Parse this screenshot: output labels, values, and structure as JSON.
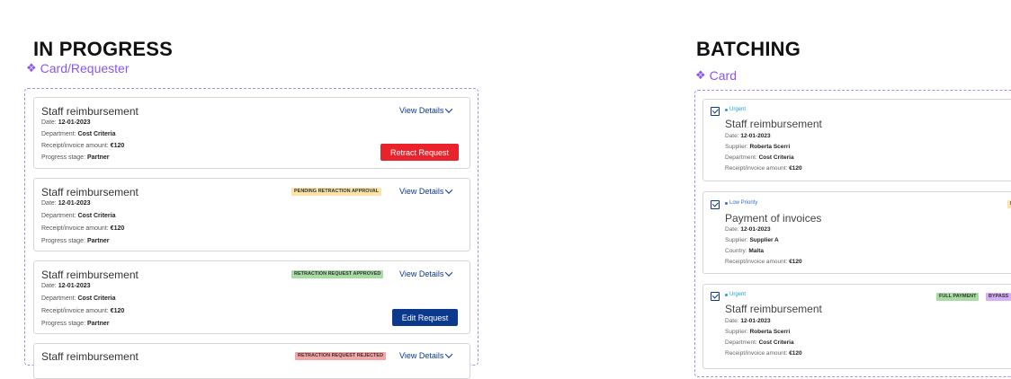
{
  "colors": {
    "accent_purple": "#8a56f0",
    "navy": "#0b3a8c",
    "red_button": "#e8232b",
    "urgent": "#1ba1d6",
    "low_priority": "#2e6fd6"
  },
  "in_progress": {
    "title": "IN PROGRESS",
    "component": "Card/Requester",
    "cards": [
      {
        "title": "Staff reimbursement",
        "date_label": "Date:",
        "date": "12-01-2023",
        "department_label": "Department:",
        "department": "Cost Criteria",
        "amount_label": "Receipt/invoice amount:",
        "amount": "€120",
        "stage_label": "Progress stage:",
        "stage": "Partner",
        "view_details": "View Details",
        "badge": "",
        "action": "Retract Request"
      },
      {
        "title": "Staff reimbursement",
        "date_label": "Date:",
        "date": "12-01-2023",
        "department_label": "Department:",
        "department": "Cost Criteria",
        "amount_label": "Receipt/invoice amount:",
        "amount": "€120",
        "stage_label": "Progress stage:",
        "stage": "Partner",
        "view_details": "View Details",
        "badge": "PENDING RETRACTION APPROVAL",
        "action": ""
      },
      {
        "title": "Staff reimbursement",
        "date_label": "Date:",
        "date": "12-01-2023",
        "department_label": "Department:",
        "department": "Cost Criteria",
        "amount_label": "Receipt/invoice amount:",
        "amount": "€120",
        "stage_label": "Progress stage:",
        "stage": "Partner",
        "view_details": "View Details",
        "badge": "RETRACTION REQUEST APPROVED",
        "action": "Edit Request"
      },
      {
        "title": "Staff reimbursement",
        "view_details": "View Details",
        "badge": "RETRACTION REQUEST REJECTED"
      }
    ]
  },
  "batching": {
    "title": "BATCHING",
    "component": "Card",
    "cards": [
      {
        "priority": "Urgent",
        "title": "Staff reimbursement",
        "date_label": "Date:",
        "date": "12-01-2023",
        "supplier_label": "Supplier:",
        "supplier": "Roberta Scerri",
        "department_label": "Department:",
        "department": "Cost Criteria",
        "amount_label": "Receipt/invoice amount:",
        "amount": "€120"
      },
      {
        "priority": "Low Priority",
        "title": "Payment of invoices",
        "date_label": "Date:",
        "date": "12-01-2023",
        "supplier_label": "Supplier:",
        "supplier": "Supplier A",
        "country_label": "Country:",
        "country": "Malta",
        "amount_label": "Receipt/invoice amount:",
        "amount": "€120",
        "badge_partial": "P"
      },
      {
        "priority": "Urgent",
        "title": "Staff reimbursement",
        "date_label": "Date:",
        "date": "12-01-2023",
        "supplier_label": "Supplier:",
        "supplier": "Roberta Scerri",
        "department_label": "Department:",
        "department": "Cost Criteria",
        "amount_label": "Receipt/invoice amount:",
        "amount": "€120",
        "badges": [
          "FULL PAYMENT",
          "BYPASS"
        ]
      }
    ]
  }
}
